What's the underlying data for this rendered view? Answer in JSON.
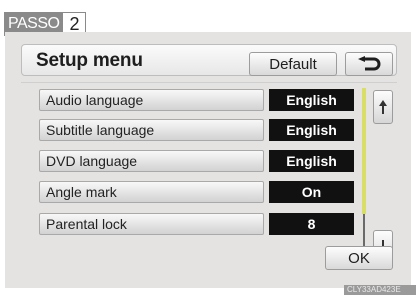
{
  "step": {
    "label": "PASSO",
    "number": "2"
  },
  "header": {
    "title": "Setup menu",
    "default_label": "Default",
    "back_icon": "back-arrow-icon"
  },
  "rows": [
    {
      "label": "Audio language",
      "value": "English"
    },
    {
      "label": "Subtitle language",
      "value": "English"
    },
    {
      "label": "DVD language",
      "value": "English"
    },
    {
      "label": "Angle mark",
      "value": "On"
    },
    {
      "label": "Parental lock",
      "value": "8"
    }
  ],
  "scroll": {
    "up_icon": "scroll-up-icon",
    "down_icon": "scroll-down-icon"
  },
  "footer": {
    "ok_label": "OK"
  },
  "watermark": "CLY33AD423E",
  "colors": {
    "panel": "#e4e3e2",
    "value_bg": "#111111",
    "scroll_thumb": "#d9de68"
  }
}
